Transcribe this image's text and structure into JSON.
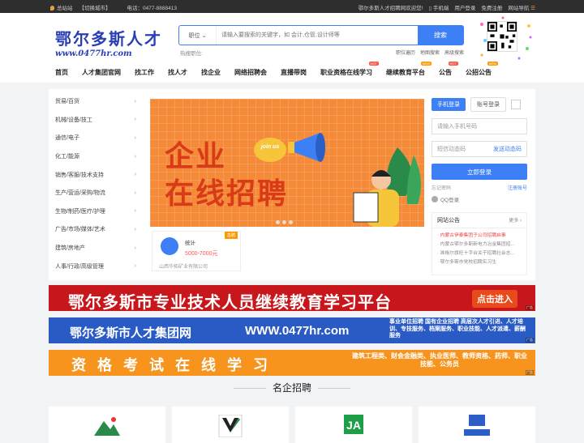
{
  "topbar": {
    "site": "总站站",
    "switch": "【切换城市】",
    "phone": "电话：0477-8888413",
    "welcome": "鄂尔多斯人才招聘网欢迎您!",
    "mobile": "手机端",
    "user_center": "用户登录",
    "register": "免费注册",
    "site_nav": "网站导航"
  },
  "logo": {
    "cn": "鄂尔多斯人才",
    "url": "www.0477hr.com"
  },
  "search": {
    "type": "职位",
    "placeholder": "请输入要搜索的关键字，如 会计,仓管,设计师等",
    "button": "搜索",
    "hot": "热搜职位:"
  },
  "sublinks": [
    "职位遍历",
    "地图搜索",
    "高级搜索"
  ],
  "nav": [
    {
      "label": "首页"
    },
    {
      "label": "人才集团官网"
    },
    {
      "label": "找工作"
    },
    {
      "label": "找人才"
    },
    {
      "label": "找企业"
    },
    {
      "label": "网络招聘会"
    },
    {
      "label": "直播带岗"
    },
    {
      "label": "职业资格在线学习",
      "badge": "HOT"
    },
    {
      "label": "继续教育平台",
      "badge": "NEW"
    },
    {
      "label": "公告",
      "badge": "HOT"
    },
    {
      "label": "公招公告",
      "badge": "NEW"
    }
  ],
  "categories": [
    "贸易/百货",
    "机械/设备/技工",
    "通信/电子",
    "化工/能源",
    "销售/客服/技术支持",
    "生产/营运/采购/物流",
    "生物/制药/医疗/护理",
    "广告/市场/媒体/艺术",
    "建筑/房地产",
    "人事/行政/高级管理"
  ],
  "banner": {
    "line1": "企业",
    "line2": "在线招聘",
    "join": "join us"
  },
  "job": {
    "title": "统计",
    "salary": "5000-7000元",
    "company": "山西华拓矿业有限公司",
    "urgent": "急聘"
  },
  "login": {
    "tab1": "手机登录",
    "tab2": "账号登录",
    "phone_ph": "请输入手机号码",
    "code_ph": "短信动态码",
    "send": "发送动态码",
    "btn": "立即登录",
    "forgot": "忘记密码",
    "reg": "注册账号",
    "qq": "QQ登录"
  },
  "notice": {
    "title": "网站公告",
    "more": "更多",
    "items": [
      "内蒙古伊泰集团子公司招聘启事",
      "内蒙古鄂尔多斯新电力冶金集团招...",
      "准格尔旗旺十字台关于招聘社会志...",
      "鄂尔多斯市党校招聘实习生"
    ]
  },
  "ads": {
    "ad1": "鄂尔多斯市专业技术人员继续教育学习平台",
    "ad1_cta": "点击进入",
    "ad2_title": "鄂尔多斯市人才集团网",
    "ad2_url": "WWW.0477hr.com",
    "ad2_desc": "事业单位招聘 国有企业招聘 高层次人才引进、人才培训、专技服务、档案服务、职业技能、人才派遣、薪酬服务",
    "ad3": "资格考试在线学习",
    "ad3_desc": "建筑工程类、财会金融类、执业医师、教师资格、药师、职业技能、公务员",
    "tag": "广告"
  },
  "section": {
    "title": "名企招聘"
  },
  "colors": {
    "primary": "#3d7ff5",
    "logo": "#2b3fb5",
    "banner": "#f58a38",
    "ad1": "#c8171c",
    "ad2": "#2a5bc5",
    "ad3": "#f7941d"
  }
}
